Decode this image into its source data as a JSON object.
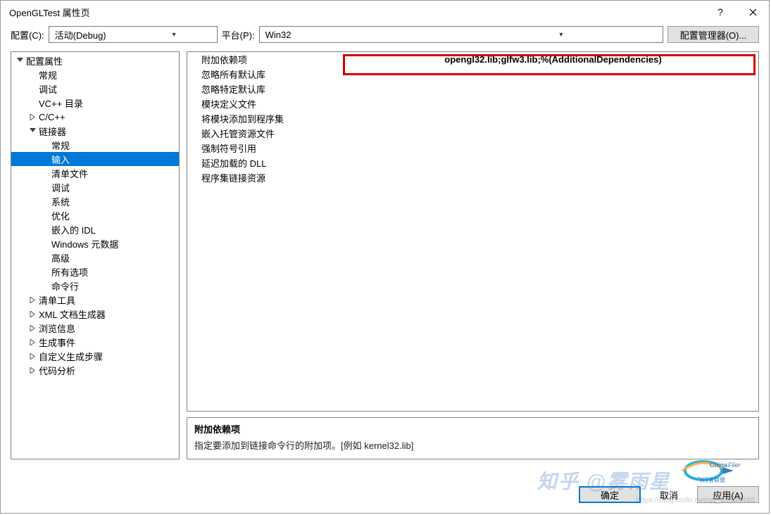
{
  "window": {
    "title": "OpenGLTest 属性页",
    "help_tooltip": "?",
    "close_tooltip": "×"
  },
  "toolbar": {
    "config_label": "配置(C):",
    "config_value": "活动(Debug)",
    "platform_label": "平台(P):",
    "platform_value": "Win32",
    "manager_button": "配置管理器(O)..."
  },
  "tree": [
    {
      "label": "配置属性",
      "indent": 0,
      "twisty": "down",
      "selected": false
    },
    {
      "label": "常规",
      "indent": 1,
      "twisty": "",
      "selected": false
    },
    {
      "label": "调试",
      "indent": 1,
      "twisty": "",
      "selected": false
    },
    {
      "label": "VC++ 目录",
      "indent": 1,
      "twisty": "",
      "selected": false
    },
    {
      "label": "C/C++",
      "indent": 1,
      "twisty": "right",
      "selected": false
    },
    {
      "label": "链接器",
      "indent": 1,
      "twisty": "down",
      "selected": false
    },
    {
      "label": "常规",
      "indent": 2,
      "twisty": "",
      "selected": false
    },
    {
      "label": "输入",
      "indent": 2,
      "twisty": "",
      "selected": true
    },
    {
      "label": "清单文件",
      "indent": 2,
      "twisty": "",
      "selected": false
    },
    {
      "label": "调试",
      "indent": 2,
      "twisty": "",
      "selected": false
    },
    {
      "label": "系统",
      "indent": 2,
      "twisty": "",
      "selected": false
    },
    {
      "label": "优化",
      "indent": 2,
      "twisty": "",
      "selected": false
    },
    {
      "label": "嵌入的 IDL",
      "indent": 2,
      "twisty": "",
      "selected": false
    },
    {
      "label": "Windows 元数据",
      "indent": 2,
      "twisty": "",
      "selected": false
    },
    {
      "label": "高级",
      "indent": 2,
      "twisty": "",
      "selected": false
    },
    {
      "label": "所有选项",
      "indent": 2,
      "twisty": "",
      "selected": false
    },
    {
      "label": "命令行",
      "indent": 2,
      "twisty": "",
      "selected": false
    },
    {
      "label": "清单工具",
      "indent": 1,
      "twisty": "right",
      "selected": false
    },
    {
      "label": "XML 文档生成器",
      "indent": 1,
      "twisty": "right",
      "selected": false
    },
    {
      "label": "浏览信息",
      "indent": 1,
      "twisty": "right",
      "selected": false
    },
    {
      "label": "生成事件",
      "indent": 1,
      "twisty": "right",
      "selected": false
    },
    {
      "label": "自定义生成步骤",
      "indent": 1,
      "twisty": "right",
      "selected": false
    },
    {
      "label": "代码分析",
      "indent": 1,
      "twisty": "right",
      "selected": false
    }
  ],
  "properties": [
    {
      "label": "附加依赖项",
      "value": "opengl32.lib;glfw3.lib;%(AdditionalDependencies)",
      "highlighted": true
    },
    {
      "label": "忽略所有默认库",
      "value": ""
    },
    {
      "label": "忽略特定默认库",
      "value": ""
    },
    {
      "label": "模块定义文件",
      "value": ""
    },
    {
      "label": "将模块添加到程序集",
      "value": ""
    },
    {
      "label": "嵌入托管资源文件",
      "value": ""
    },
    {
      "label": "强制符号引用",
      "value": ""
    },
    {
      "label": "延迟加载的 DLL",
      "value": ""
    },
    {
      "label": "程序集链接资源",
      "value": ""
    }
  ],
  "description": {
    "title": "附加依赖项",
    "body": "指定要添加到链接命令行的附加项。[例如 kernel32.lib]"
  },
  "footer": {
    "ok": "确定",
    "cancel": "取消",
    "apply": "应用(A)"
  },
  "watermarks": {
    "text1": "知乎  @雾雨星",
    "text2": "ChinaAFlier",
    "sub2": "飞行者联盟",
    "url": "https://blog.csdn.net/qq_38898488"
  }
}
